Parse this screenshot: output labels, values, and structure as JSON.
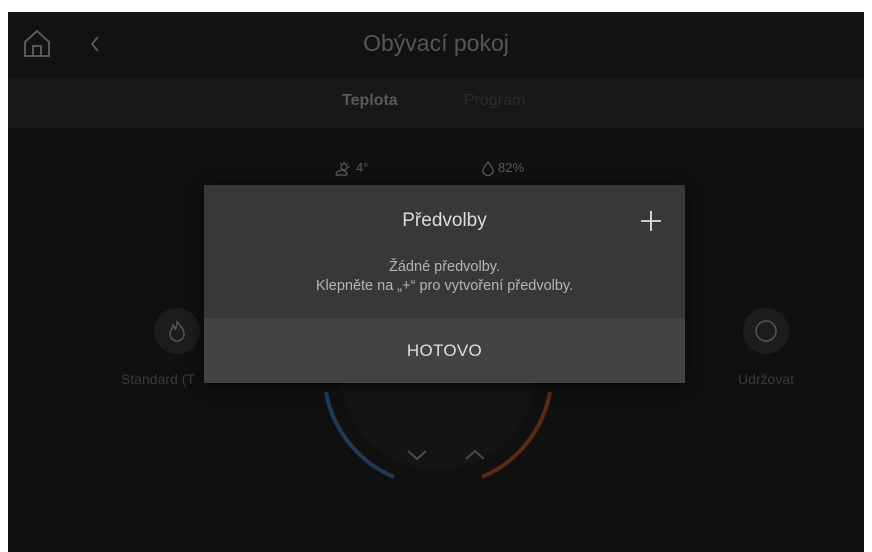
{
  "header": {
    "title": "Obývací pokoj",
    "home_icon": "home-icon",
    "back_icon": "chevron-left-icon"
  },
  "tabs": [
    {
      "label": "Teplota",
      "active": true
    },
    {
      "label": "Program",
      "active": false
    }
  ],
  "weather": {
    "temperature": "4°",
    "humidity": "82%",
    "temperature_icon": "sun-cloud-icon",
    "humidity_icon": "droplet-icon"
  },
  "modes": {
    "left": {
      "label": "Standard (T",
      "icon": "flame-icon"
    },
    "right": {
      "label": "Udržovat",
      "icon": "circle-icon"
    }
  },
  "dialog": {
    "title": "Předvolby",
    "message_line1": "Žádné předvolby.",
    "message_line2": "Klepněte na „+“ pro vytvoření předvolby.",
    "done_label": "HOTOVO",
    "add_icon": "plus-icon"
  },
  "colors": {
    "dial_cool": "#1f3a56",
    "dial_warm": "#5a2a12"
  }
}
